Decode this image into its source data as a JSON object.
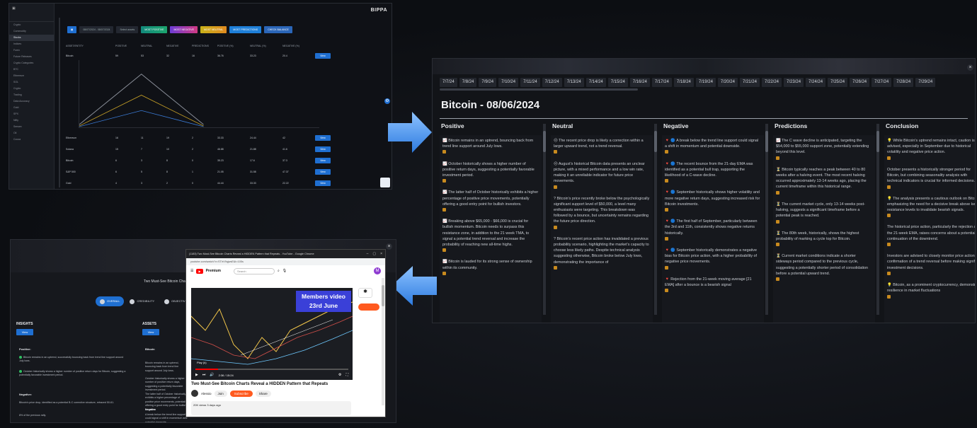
{
  "dashboard": {
    "brand": "BIPPA",
    "sidebar": [
      "Crypto",
      "Commodity",
      "Stocks",
      "Indices",
      "Forex",
      "Future Releases",
      "Crypto Categories",
      "BTC",
      "Ethereum",
      "SOL",
      "Crypto",
      "Trading",
      "Data Accuracy",
      "Gold",
      "SPX",
      "Nifty",
      "Sensex",
      "Oil",
      "Cocoa"
    ],
    "toolbar": {
      "date_range": "08/07/2024 - 08/07/2024",
      "select": "Select assets",
      "b1": "MOST POSITIVE",
      "b2": "MOST NEGATIVE",
      "b3": "MOST NEUTRAL",
      "b4": "MOST PREDICTIONS",
      "b5": "CHECK BALANCE"
    },
    "headers": [
      "ASSET/ENTITY",
      "POSITIVE",
      "NEUTRAL",
      "NEGATIVE",
      "PREDICTIONS",
      "POSITIVE (%)",
      "NEUTRAL (%)",
      "NEGATIVE (%)",
      ""
    ],
    "rows": [
      {
        "name": "Bitcoin",
        "c": [
          "59",
          "53",
          "32",
          "16",
          "36.76",
          "33.23",
          "20.4"
        ],
        "btn": "View"
      },
      {
        "name": "Ethereum",
        "c": [
          "16",
          "11",
          "19",
          "2",
          "33.33",
          "24.44",
          "42"
        ],
        "btn": "View"
      },
      {
        "name": "Solana",
        "c": [
          "15",
          "7",
          "10",
          "2",
          "46.88",
          "21.88",
          "41.6"
        ],
        "btn": "View"
      },
      {
        "name": "Bitcoin",
        "c": [
          "6",
          "3",
          "8",
          "0",
          "35.23",
          "17.6",
          "37.3"
        ],
        "btn": "View"
      },
      {
        "name": "S&P 500",
        "c": [
          "6",
          "5",
          "8",
          "1",
          "21.05",
          "31.58",
          "47.37"
        ],
        "btn": "View"
      },
      {
        "name": "Gold",
        "c": [
          "4",
          "3",
          "2",
          "0",
          "44.44",
          "33.33",
          "22.22"
        ],
        "btn": "View"
      }
    ]
  },
  "analysis": {
    "dates": [
      "7/7/24",
      "7/8/24",
      "7/9/24",
      "7/10/24",
      "7/11/24",
      "7/12/24",
      "7/13/24",
      "7/14/24",
      "7/15/24",
      "7/16/24",
      "7/17/24",
      "7/18/24",
      "7/19/24",
      "7/20/24",
      "7/21/24",
      "7/22/24",
      "7/23/24",
      "7/24/24",
      "7/25/24",
      "7/26/24",
      "7/27/24",
      "7/28/24",
      "7/29/24"
    ],
    "title": "Bitcoin - 08/06/2024",
    "columns": [
      {
        "name": "Positive",
        "items": [
          "📈 Bitcoin remains in an uptrend, bouncing back from trend line support around July lows.",
          "📈 October historically shows a higher number of positive return days, suggesting a potentially favorable investment period.",
          "📈 The latter half of October historically exhibits a higher percentage of positive price movements, potentially offering a good entry point for bullish investors.",
          "📈 Breaking above $65,000 - $66,000 is crucial for bullish momentum. Bitcoin needs to surpass this resistance zone, in addition to the 21 week TMA, to signal a potential trend reversal and increase the probability of reaching new all-time highs.",
          "📈 Bitcoin is lauded for its strong sense of ownership within its community."
        ]
      },
      {
        "name": "Neutral",
        "items": [
          "😐 The recent price drop is likely a correction within a larger upward trend, not a trend reversal.",
          "😐 August's historical Bitcoin data presents an unclear picture, with a mixed performance and a low win rate, making it an unreliable indicator for future price movements.",
          "? Bitcoin's price recently broke below the psychologically significant support level of $50,000, a level many enthusiasts were targeting. This breakdown was followed by a bounce, but uncertainty remains regarding the future price direction.",
          "? Bitcoin's recent price action has invalidated a previous probability scenario, highlighting the market's capacity to choose less likely paths. Despite technical analysis suggesting otherwise, Bitcoin broke below July lows, demonstrating the importance of"
        ]
      },
      {
        "name": "Negative",
        "items": [
          "🔻 🔵 A break below the trend line support could signal a shift in momentum and potential downside.",
          "🔻 🔵 The recent bounce from the 21-day EMA was identified as a potential bull trap, supporting the likelihood of a C-wave decline.",
          "🔻 🔵 September historically shows higher volatility and more negative return days, suggesting increased risk for Bitcoin investments.",
          "🔻 🔵 The first half of September, particularly between the 3rd and 11th, consistently shows negative returns historically.",
          "🔻 🔵 September historically demonstrates a negative bias for Bitcoin price action, with a higher probability of negative price movements.",
          "🔻 Rejection from the 21-week moving average [21 EMA] after a bounce is a bearish signal"
        ]
      },
      {
        "name": "Predictions",
        "items": [
          "📈 The C wave decline is anticipated, targeting the $54,000 to $55,000 support zone, potentially extending beyond this level.",
          "⏳ Bitcoin typically reaches a peak between 40 to 80 weeks after a halving event. The most recent halving occurred approximately 13-14 weeks ago, placing the current timeframe within this historical range.",
          "⏳ The current market cycle, only 13-14 weeks post-halving, suggests a significant timeframe before a potential peak is reached.",
          "⏳ The 80th week, historically, shows the highest probability of marking a cycle top for Bitcoin.",
          "⏳ Current market conditions indicate a shorter sideways period compared to the previous cycle, suggesting a potentially shorter period of consolidation before a potential upward trend."
        ]
      },
      {
        "name": "Conclusion",
        "items": [
          "💡 While Bitcoin's uptrend remains intact, caution is advised, especially in September due to historical volatility and negative price action.",
          "October presents a historically stronger period for Bitcoin, but combining seasonality analysis with technical indicators is crucial for informed decisions.",
          "💡 The analysis presents a cautious outlook on Bitcoin, emphasizing the need for a decisive break above key resistance levels to invalidate bearish signals.",
          "The historical price action, particularly the rejection at the 21-week EMA, raises concerns about a potential continuation of the downtrend.",
          "Investors are advised to closely monitor price action for confirmation of a trend reversal before making significant investment decisions.",
          "💡 Bitcoin, as a prominent cryptocurrency, demonstrates resilience in market fluctuations"
        ]
      }
    ]
  },
  "insights": {
    "heading": "Two Must-See Bitcoin Charts Reveal a HIDDEN Pattern that Repeats",
    "tabs": [
      "OVERALL",
      "CREDIBILITY",
      "OBJECTIVITY"
    ],
    "left_title": "INSIGHTS",
    "mid_title": "ASSETS",
    "view": "View",
    "positive_label": "Positive:",
    "pos1": "Bitcoin remains in an uptrend, successfully bouncing back from trend line support around July lows.",
    "pos2": "October historically shows a higher number of positive return days for Bitcoin, suggesting a potentially favorable investment period.",
    "negative_label": "Negative:",
    "neg1": "Bitcoin's price drop, identified as a potential B-C corrective structure, retraced 50-61.",
    "neg2": "8% of the previous rally.",
    "asset_name": "Bitcoin",
    "asset_text1": "Bitcoin remains in an uptrend, bouncing back from trend line support around July lows.",
    "asset_text2": "October historically shows a higher number of positive return days, suggesting a potentially favorable investment period.",
    "asset_text3": "The latter half of October historically exhibits a higher percentage of positive price movements, potentially offering a good entry point for bullish investors.",
    "asset_neg_label": "Negative",
    "asset_neg": "A break below the trend line support could signal a shift in momentum and potential downside."
  },
  "youtube": {
    "window_title": "(1183) Two Must-See Bitcoin Charts Reveal a HIDDEN Pattern that Repeats - YouTube - Google Chrome",
    "url": "youtube.com/watch?v=STIrV9qjwsE&t=105s",
    "logo": "Premium",
    "search_placeholder": "Search",
    "avatar": "M",
    "members_line1": "Members video",
    "members_line2": "23rd June",
    "time": "2:36 / 15:24",
    "play_by": "Play (k)",
    "video_title": "Two Must-See Bitcoin Charts Reveal a HIDDEN Pattern that Repeats",
    "channel": "Alessio",
    "subscribe": "Subscribe",
    "share": "Share",
    "join": "Join",
    "views": "20K views 3 days ago"
  },
  "colors": {
    "accent_blue": "#1f6fd1",
    "arrow": "#4a90e2"
  }
}
